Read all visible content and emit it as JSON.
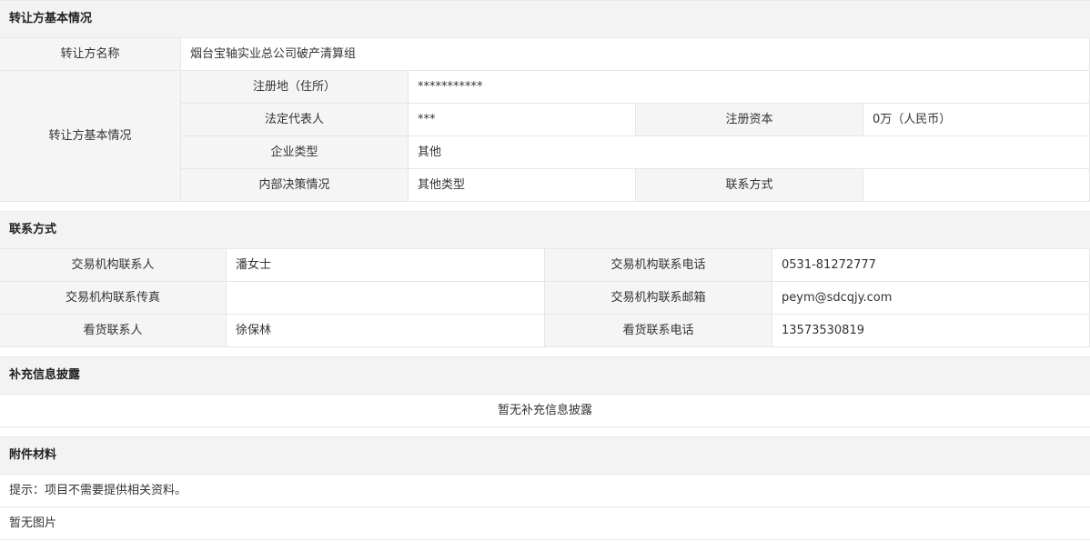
{
  "section_transferor": {
    "title": "转让方基本情况",
    "name_label": "转让方名称",
    "name_value": "烟台宝轴实业总公司破产清算组",
    "basic_label": "转让方基本情况",
    "address_label": "注册地（住所）",
    "address_value": "***********",
    "legal_rep_label": "法定代表人",
    "legal_rep_value": "***",
    "capital_label": "注册资本",
    "capital_value": "0万（人民币）",
    "type_label": "企业类型",
    "type_value": "其他",
    "decision_label": "内部决策情况",
    "decision_value": "其他类型",
    "contact_label": "联系方式",
    "contact_value": ""
  },
  "section_contact": {
    "title": "联系方式",
    "agency_contact_label": "交易机构联系人",
    "agency_contact_value": "潘女士",
    "agency_phone_label": "交易机构联系电话",
    "agency_phone_value": "0531-81272777",
    "agency_fax_label": "交易机构联系传真",
    "agency_fax_value": "",
    "agency_email_label": "交易机构联系邮箱",
    "agency_email_value": "peym@sdcqjy.com",
    "viewing_contact_label": "看货联系人",
    "viewing_contact_value": "徐保林",
    "viewing_phone_label": "看货联系电话",
    "viewing_phone_value": "13573530819"
  },
  "section_supplement": {
    "title": "补充信息披露",
    "empty_text": "暂无补充信息披露"
  },
  "section_attachments": {
    "title": "附件材料",
    "tip_text": "提示：项目不需要提供相关资料。",
    "no_images_text": "暂无图片"
  }
}
